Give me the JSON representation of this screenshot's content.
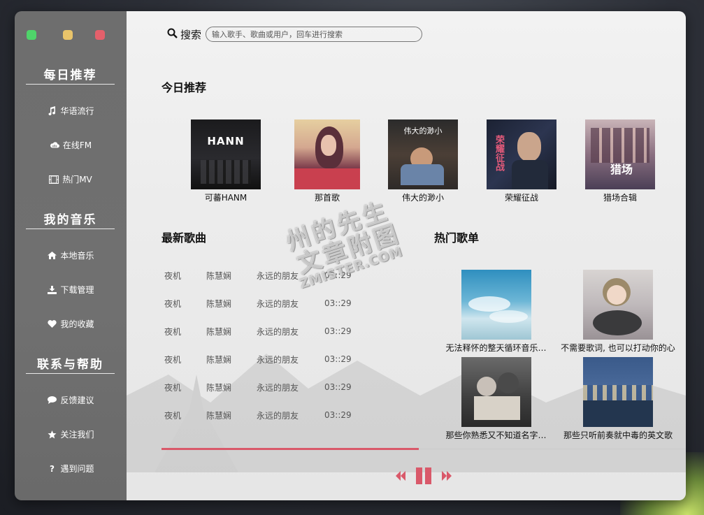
{
  "sidebar": {
    "sections": [
      {
        "title": "每日推荐",
        "items": [
          {
            "label": "华语流行",
            "icon": "music-note-icon"
          },
          {
            "label": "在线FM",
            "icon": "cloud-icon"
          },
          {
            "label": "热门MV",
            "icon": "film-icon"
          }
        ]
      },
      {
        "title": "我的音乐",
        "items": [
          {
            "label": "本地音乐",
            "icon": "home-icon"
          },
          {
            "label": "下载管理",
            "icon": "download-icon"
          },
          {
            "label": "我的收藏",
            "icon": "heart-icon"
          }
        ]
      },
      {
        "title": "联系与帮助",
        "items": [
          {
            "label": "反馈建议",
            "icon": "comment-icon"
          },
          {
            "label": "关注我们",
            "icon": "star-icon"
          },
          {
            "label": "遇到问题",
            "icon": "question-icon"
          }
        ]
      }
    ]
  },
  "search": {
    "label": "搜索",
    "placeholder": "输入歌手、歌曲或用户，回车进行搜索"
  },
  "today": {
    "title": "今日推荐",
    "albums": [
      {
        "name": "可蕃HANM",
        "cover_text": "HANN"
      },
      {
        "name": "那首歌",
        "cover_text": ""
      },
      {
        "name": "伟大的渺小",
        "cover_text": "伟大的渺小"
      },
      {
        "name": "荣耀征战",
        "cover_text": "荣耀征战"
      },
      {
        "name": "猎场合辑",
        "cover_text": "猎场"
      }
    ]
  },
  "latest": {
    "title": "最新歌曲",
    "songs": [
      {
        "title": "夜机",
        "artist": "陈慧娴",
        "album": "永远的朋友",
        "duration": "03::29"
      },
      {
        "title": "夜机",
        "artist": "陈慧娴",
        "album": "永远的朋友",
        "duration": "03::29"
      },
      {
        "title": "夜机",
        "artist": "陈慧娴",
        "album": "永远的朋友",
        "duration": "03::29"
      },
      {
        "title": "夜机",
        "artist": "陈慧娴",
        "album": "永远的朋友",
        "duration": "03::29"
      },
      {
        "title": "夜机",
        "artist": "陈慧娴",
        "album": "永远的朋友",
        "duration": "03::29"
      },
      {
        "title": "夜机",
        "artist": "陈慧娴",
        "album": "永远的朋友",
        "duration": "03::29"
      }
    ]
  },
  "hot": {
    "title": "热门歌单",
    "playlists": [
      {
        "name": "无法释怀的整天循环音乐…"
      },
      {
        "name": "不需要歌词, 也可以打动你的心"
      },
      {
        "name": "那些你熟悉又不知道名字…"
      },
      {
        "name": "那些只听前奏就中毒的英文歌"
      }
    ]
  },
  "player": {
    "progress": 0.49,
    "accent": "#d9596a"
  },
  "watermark": {
    "line1": "州的先生",
    "line2": "文章附图",
    "line3": "ZMISTER.COM"
  },
  "colors": {
    "sidebar": "#6e6e6e",
    "traffic_green": "#4fd46a",
    "traffic_yellow": "#e9c46a",
    "traffic_red": "#e4606b"
  }
}
